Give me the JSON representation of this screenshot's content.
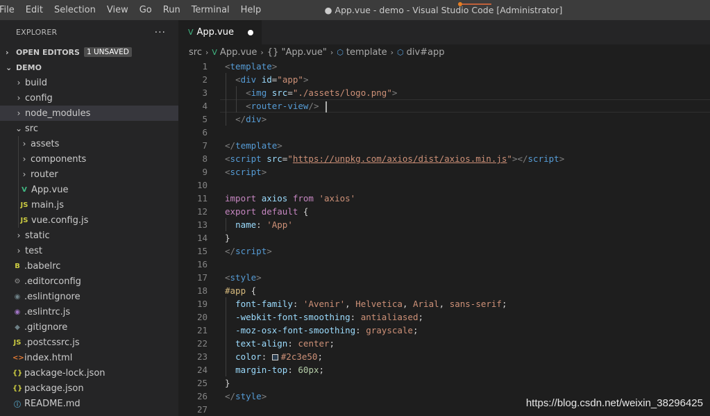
{
  "menu": [
    "File",
    "Edit",
    "Selection",
    "View",
    "Go",
    "Run",
    "Terminal",
    "Help"
  ],
  "window_title": "● App.vue - demo - Visual Studio Code [Administrator]",
  "sidebar": {
    "title": "EXPLORER",
    "more": "···",
    "open_editors": "OPEN EDITORS",
    "unsaved_badge": "1 UNSAVED",
    "project": "DEMO",
    "items": [
      {
        "label": "build",
        "type": "folder",
        "open": false,
        "depth": 0
      },
      {
        "label": "config",
        "type": "folder",
        "open": false,
        "depth": 0
      },
      {
        "label": "node_modules",
        "type": "folder",
        "open": false,
        "depth": 0,
        "selected": true
      },
      {
        "label": "src",
        "type": "folder",
        "open": true,
        "depth": 0
      },
      {
        "label": "assets",
        "type": "folder",
        "open": false,
        "depth": 1
      },
      {
        "label": "components",
        "type": "folder",
        "open": false,
        "depth": 1
      },
      {
        "label": "router",
        "type": "folder",
        "open": false,
        "depth": 1
      },
      {
        "label": "App.vue",
        "type": "vue",
        "depth": 1
      },
      {
        "label": "main.js",
        "type": "js",
        "depth": 1
      },
      {
        "label": "vue.config.js",
        "type": "js",
        "depth": 1
      },
      {
        "label": "static",
        "type": "folder",
        "open": false,
        "depth": 0
      },
      {
        "label": "test",
        "type": "folder",
        "open": false,
        "depth": 0
      },
      {
        "label": ".babelrc",
        "type": "babel",
        "depth": 0
      },
      {
        "label": ".editorconfig",
        "type": "gear",
        "depth": 0
      },
      {
        "label": ".eslintignore",
        "type": "ignore",
        "depth": 0
      },
      {
        "label": ".eslintrc.js",
        "type": "eslint",
        "depth": 0
      },
      {
        "label": ".gitignore",
        "type": "git",
        "depth": 0
      },
      {
        "label": ".postcssrc.js",
        "type": "js",
        "depth": 0
      },
      {
        "label": "index.html",
        "type": "html",
        "depth": 0
      },
      {
        "label": "package-lock.json",
        "type": "json",
        "depth": 0
      },
      {
        "label": "package.json",
        "type": "json",
        "depth": 0
      },
      {
        "label": "README.md",
        "type": "info",
        "depth": 0
      }
    ]
  },
  "icons": {
    "js": "JS",
    "vue": "V",
    "json": "{}",
    "babel": "B",
    "gear": "⚙",
    "ignore": "◉",
    "eslint": "◉",
    "git": "◆",
    "html": "<>",
    "info": "ⓘ"
  },
  "tab": {
    "label": "App.vue",
    "dirty": true
  },
  "breadcrumb": [
    "src",
    "App.vue",
    "{} \"App.vue\"",
    "template",
    "div#app"
  ],
  "code": [
    [
      [
        "t-punc",
        "<"
      ],
      [
        "t-tag",
        "template"
      ],
      [
        "t-punc",
        ">"
      ]
    ],
    [
      [
        "t-plain",
        "  "
      ],
      [
        "t-punc",
        "<"
      ],
      [
        "t-tag",
        "div"
      ],
      [
        "t-plain",
        " "
      ],
      [
        "t-attr",
        "id"
      ],
      [
        "t-plain",
        "="
      ],
      [
        "t-str",
        "\"app\""
      ],
      [
        "t-punc",
        ">"
      ]
    ],
    [
      [
        "t-plain",
        "    "
      ],
      [
        "t-punc",
        "<"
      ],
      [
        "t-tag",
        "img"
      ],
      [
        "t-plain",
        " "
      ],
      [
        "t-attr",
        "src"
      ],
      [
        "t-plain",
        "="
      ],
      [
        "t-str",
        "\"./assets/logo.png\""
      ],
      [
        "t-punc",
        ">"
      ]
    ],
    [
      [
        "t-plain",
        "    "
      ],
      [
        "t-punc",
        "<"
      ],
      [
        "t-tag",
        "router-view"
      ],
      [
        "t-punc",
        "/>"
      ],
      [
        "t-plain",
        " "
      ],
      [
        "cursor",
        ""
      ]
    ],
    [
      [
        "t-plain",
        "  "
      ],
      [
        "t-punc",
        "</"
      ],
      [
        "t-tag",
        "div"
      ],
      [
        "t-punc",
        ">"
      ]
    ],
    [],
    [
      [
        "t-punc",
        "</"
      ],
      [
        "t-tag",
        "template"
      ],
      [
        "t-punc",
        ">"
      ]
    ],
    [
      [
        "t-punc",
        "<"
      ],
      [
        "t-tag",
        "script"
      ],
      [
        "t-plain",
        " "
      ],
      [
        "t-attr",
        "src"
      ],
      [
        "t-plain",
        "="
      ],
      [
        "t-str",
        "\""
      ],
      [
        "t-link",
        "https://unpkg.com/axios/dist/axios.min.js"
      ],
      [
        "t-str",
        "\""
      ],
      [
        "t-punc",
        "></"
      ],
      [
        "t-tag",
        "script"
      ],
      [
        "t-punc",
        ">"
      ]
    ],
    [
      [
        "t-punc",
        "<"
      ],
      [
        "t-tag",
        "script"
      ],
      [
        "t-punc",
        ">"
      ]
    ],
    [],
    [
      [
        "t-kw",
        "import"
      ],
      [
        "t-plain",
        " "
      ],
      [
        "t-var",
        "axios"
      ],
      [
        "t-plain",
        " "
      ],
      [
        "t-kw",
        "from"
      ],
      [
        "t-plain",
        " "
      ],
      [
        "t-str",
        "'axios'"
      ]
    ],
    [
      [
        "t-kw",
        "export"
      ],
      [
        "t-plain",
        " "
      ],
      [
        "t-kw",
        "default"
      ],
      [
        "t-plain",
        " {"
      ]
    ],
    [
      [
        "t-plain",
        "  "
      ],
      [
        "t-var",
        "name"
      ],
      [
        "t-plain",
        ": "
      ],
      [
        "t-str",
        "'App'"
      ]
    ],
    [
      [
        "t-plain",
        "}"
      ]
    ],
    [
      [
        "t-punc",
        "</"
      ],
      [
        "t-tag",
        "script"
      ],
      [
        "t-punc",
        ">"
      ]
    ],
    [],
    [
      [
        "t-punc",
        "<"
      ],
      [
        "t-tag",
        "style"
      ],
      [
        "t-punc",
        ">"
      ]
    ],
    [
      [
        "t-sel",
        "#app"
      ],
      [
        "t-plain",
        " {"
      ]
    ],
    [
      [
        "t-plain",
        "  "
      ],
      [
        "t-var",
        "font-family"
      ],
      [
        "t-plain",
        ": "
      ],
      [
        "t-val",
        "'Avenir'"
      ],
      [
        "t-plain",
        ", "
      ],
      [
        "t-val",
        "Helvetica"
      ],
      [
        "t-plain",
        ", "
      ],
      [
        "t-val",
        "Arial"
      ],
      [
        "t-plain",
        ", "
      ],
      [
        "t-val",
        "sans-serif"
      ],
      [
        "t-plain",
        ";"
      ]
    ],
    [
      [
        "t-plain",
        "  "
      ],
      [
        "t-var",
        "-webkit-font-smoothing"
      ],
      [
        "t-plain",
        ": "
      ],
      [
        "t-val",
        "antialiased"
      ],
      [
        "t-plain",
        ";"
      ]
    ],
    [
      [
        "t-plain",
        "  "
      ],
      [
        "t-var",
        "-moz-osx-font-smoothing"
      ],
      [
        "t-plain",
        ": "
      ],
      [
        "t-val",
        "grayscale"
      ],
      [
        "t-plain",
        ";"
      ]
    ],
    [
      [
        "t-plain",
        "  "
      ],
      [
        "t-var",
        "text-align"
      ],
      [
        "t-plain",
        ": "
      ],
      [
        "t-val",
        "center"
      ],
      [
        "t-plain",
        ";"
      ]
    ],
    [
      [
        "t-plain",
        "  "
      ],
      [
        "t-var",
        "color"
      ],
      [
        "t-plain",
        ": "
      ],
      [
        "swatch",
        ""
      ],
      [
        "t-val",
        "#2c3e50"
      ],
      [
        "t-plain",
        ";"
      ]
    ],
    [
      [
        "t-plain",
        "  "
      ],
      [
        "t-var",
        "margin-top"
      ],
      [
        "t-plain",
        ": "
      ],
      [
        "t-num",
        "60px"
      ],
      [
        "t-plain",
        ";"
      ]
    ],
    [
      [
        "t-plain",
        "}"
      ]
    ],
    [
      [
        "t-punc",
        "</"
      ],
      [
        "t-tag",
        "style"
      ],
      [
        "t-punc",
        ">"
      ]
    ],
    []
  ],
  "current_line": 4,
  "watermark": "https://blog.csdn.net/weixin_38296425",
  "colors": {
    "titlebar": "#3c3c3c",
    "sidebar": "#252526",
    "editor": "#1e1e1e",
    "accent_vue": "#41b883"
  }
}
